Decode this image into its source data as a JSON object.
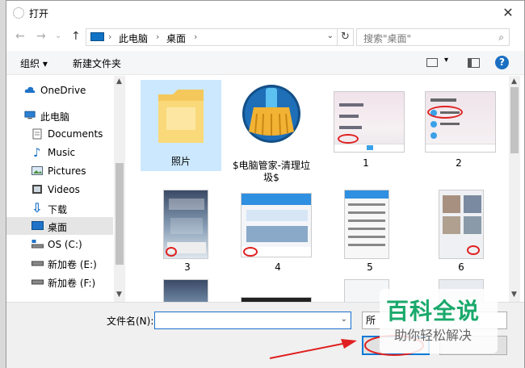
{
  "window": {
    "title": "打开",
    "close_label": "✕"
  },
  "nav": {
    "back": "←",
    "forward": "→",
    "recent": "⌄",
    "up": "↑",
    "breadcrumb": [
      "此电脑",
      "桌面"
    ],
    "separator": "›",
    "dropdown": "⌄",
    "refresh": "↻",
    "search_placeholder": "搜索\"桌面\"",
    "search_icon": "⌕"
  },
  "toolbar": {
    "organize": "组织 ▾",
    "new_folder": "新建文件夹",
    "view_dropdown": "▾",
    "help": "?"
  },
  "sidebar": {
    "items": [
      {
        "label": "OneDrive",
        "icon": "cloud-icon"
      },
      {
        "label": "此电脑",
        "icon": "computer-icon"
      },
      {
        "label": "Documents",
        "icon": "document-icon"
      },
      {
        "label": "Music",
        "icon": "music-icon"
      },
      {
        "label": "Pictures",
        "icon": "pictures-icon"
      },
      {
        "label": "Videos",
        "icon": "videos-icon"
      },
      {
        "label": "下载",
        "icon": "download-icon"
      },
      {
        "label": "桌面",
        "icon": "desktop-icon",
        "selected": true
      },
      {
        "label": "OS (C:)",
        "icon": "drive-icon"
      },
      {
        "label": "新加卷 (E:)",
        "icon": "drive-icon"
      },
      {
        "label": "新加卷 (F:)",
        "icon": "drive-icon"
      }
    ]
  },
  "files": [
    {
      "name": "照片",
      "type": "folder",
      "selected": true
    },
    {
      "name": "$电脑管家-清理垃圾$",
      "type": "app-shortcut"
    },
    {
      "name": "1",
      "type": "image"
    },
    {
      "name": "2",
      "type": "image"
    },
    {
      "name": "3",
      "type": "image"
    },
    {
      "name": "4",
      "type": "image"
    },
    {
      "name": "5",
      "type": "image"
    },
    {
      "name": "6",
      "type": "image"
    }
  ],
  "bottom": {
    "filename_label": "文件名(N):",
    "filename_value": "",
    "filetype_value": "所",
    "dropdown": "⌄"
  },
  "watermark": {
    "title": "百科全说",
    "subtitle": "助你轻松解决"
  },
  "colors": {
    "accent": "#0078d7",
    "selection": "#cce8ff",
    "watermark_green": "#19a96b",
    "annotation_red": "#e02020"
  }
}
